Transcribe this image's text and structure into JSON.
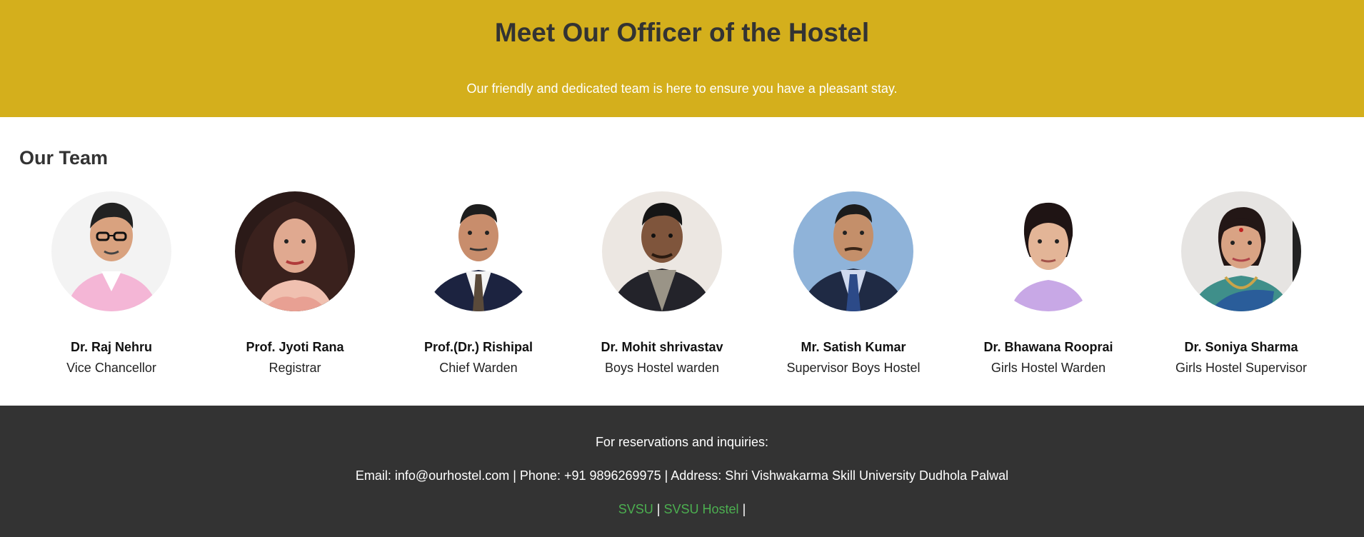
{
  "hero": {
    "title": "Meet Our Officer of the Hostel",
    "subtitle": "Our friendly and dedicated team is here to ensure you have a pleasant stay."
  },
  "team": {
    "heading": "Our Team",
    "members": [
      {
        "name": "Dr. Raj Nehru",
        "role": "Vice Chancellor"
      },
      {
        "name": "Prof. Jyoti Rana",
        "role": "Registrar"
      },
      {
        "name": "Prof.(Dr.) Rishipal",
        "role": "Chief Warden"
      },
      {
        "name": "Dr. Mohit shrivastav",
        "role": "Boys Hostel warden"
      },
      {
        "name": "Mr. Satish Kumar",
        "role": "Supervisor Boys Hostel"
      },
      {
        "name": "Dr. Bhawana Rooprai",
        "role": "Girls Hostel Warden"
      },
      {
        "name": "Dr. Soniya Sharma",
        "role": "Girls Hostel Supervisor"
      }
    ]
  },
  "footer": {
    "inquiries": "For reservations and inquiries:",
    "contact": "Email: info@ourhostel.com | Phone: +91 9896269975 | Address: Shri Vishwakarma Skill University Dudhola Palwal",
    "links": [
      {
        "label": "SVSU"
      },
      {
        "label": "SVSU Hostel"
      }
    ],
    "separator": "|"
  },
  "colors": {
    "hero_bg": "#d4af1c",
    "footer_bg": "#333333",
    "link": "#4caf50"
  }
}
